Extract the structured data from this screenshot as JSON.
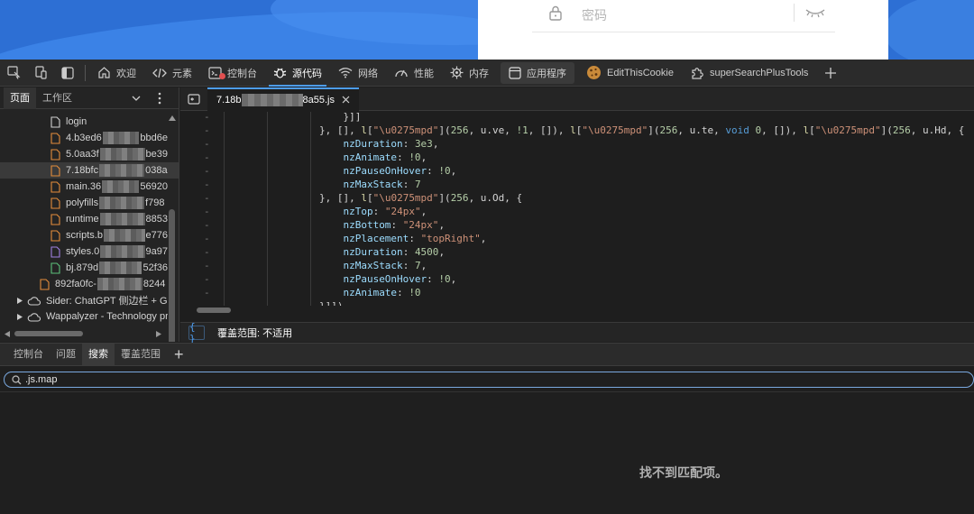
{
  "page": {
    "password_placeholder": "密码"
  },
  "toolbar": {
    "tabs": [
      {
        "label": "欢迎"
      },
      {
        "label": "元素"
      },
      {
        "label": "控制台"
      },
      {
        "label": "源代码"
      },
      {
        "label": "网络"
      },
      {
        "label": "性能"
      },
      {
        "label": "内存"
      },
      {
        "label": "应用程序"
      },
      {
        "label": "EditThisCookie"
      },
      {
        "label": "superSearchPlusTools"
      }
    ],
    "active": "源代码",
    "accent": "#4d9df0"
  },
  "navigator": {
    "tabs": [
      {
        "label": "页面"
      },
      {
        "label": "工作区"
      }
    ],
    "files": [
      {
        "a": "login",
        "b": "",
        "type": "doc"
      },
      {
        "a": "4.b3ed6",
        "b": "bbd6e",
        "type": "js"
      },
      {
        "a": "5.0aa3f",
        "b": "be39",
        "type": "js"
      },
      {
        "a": "7.18bfc",
        "b": "038a",
        "type": "js"
      },
      {
        "a": "main.36",
        "b": "56920",
        "type": "js"
      },
      {
        "a": "polyfills",
        "b": "f798",
        "type": "js"
      },
      {
        "a": "runtime",
        "b": "8853",
        "type": "js"
      },
      {
        "a": "scripts.b",
        "b": "e776",
        "type": "js"
      },
      {
        "a": "styles.0",
        "b": "9a97",
        "type": "css"
      },
      {
        "a": "bj.879d",
        "b": "52f36",
        "type": "map"
      },
      {
        "a": "892fa0fc-",
        "b": "8244",
        "type": "js"
      }
    ],
    "extensions": [
      {
        "label": "Sider: ChatGPT 侧边栏 + GP"
      },
      {
        "label": "Wappalyzer - Technology pr"
      }
    ]
  },
  "editor": {
    "tab_prefix": "7.18b",
    "tab_suffix": "8a55.js",
    "status": "覆盖范围: 不适用",
    "lines": [
      "                    }]]",
      "                }, [], l[\"\\u0275mpd\"](256, u.ve, !1, []), l[\"\\u0275mpd\"](256, u.te, void 0, []), l[\"\\u0275mpd\"](256, u.Hd, {",
      "                    nzDuration: 3e3,",
      "                    nzAnimate: !0,",
      "                    nzPauseOnHover: !0,",
      "                    nzMaxStack: 7",
      "                }, [], l[\"\\u0275mpd\"](256, u.Od, {",
      "                    nzTop: \"24px\",",
      "                    nzBottom: \"24px\",",
      "                    nzPlacement: \"topRight\",",
      "                    nzDuration: 4500,",
      "                    nzMaxStack: 7,",
      "                    nzPauseOnHover: !0,",
      "                    nzAnimate: !0",
      "                }]]),"
    ]
  },
  "drawer": {
    "tabs": [
      {
        "label": "控制台"
      },
      {
        "label": "问题"
      },
      {
        "label": "搜索"
      },
      {
        "label": "覆盖范围"
      }
    ],
    "active": "搜索",
    "search_value": ".js.map",
    "no_match": "找不到匹配项。"
  }
}
